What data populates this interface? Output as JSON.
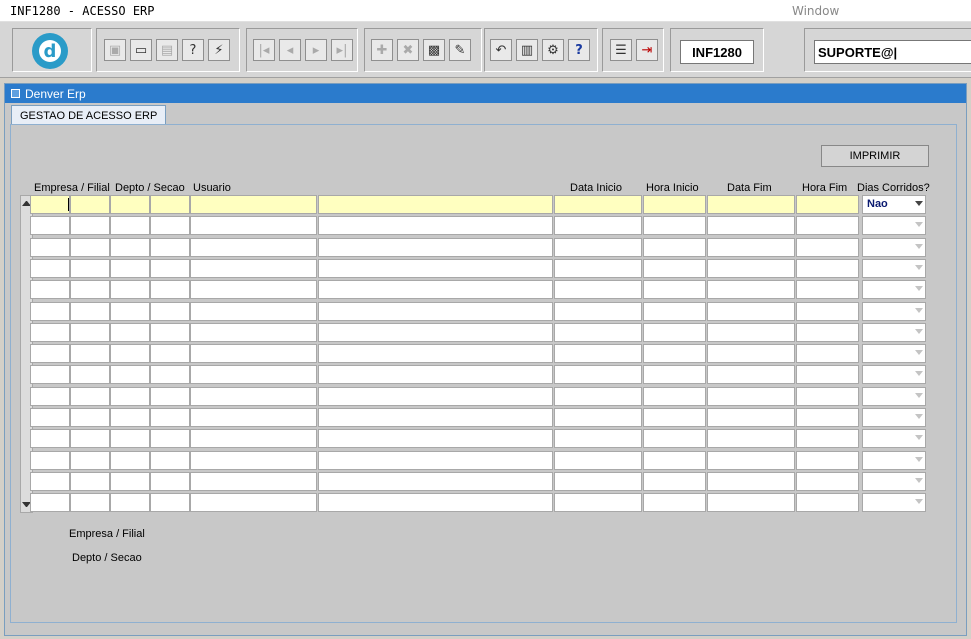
{
  "titlebar": {
    "title": "INF1280 - ACESSO ERP",
    "menu_window": "Window"
  },
  "toolbar": {
    "logo_letter": "d",
    "form_code": "INF1280",
    "user": "SUPORTE@|"
  },
  "window": {
    "title": "Denver Erp",
    "tab": "GESTAO DE ACESSO ERP"
  },
  "form": {
    "print_button": "IMPRIMIR",
    "headers": {
      "empresa": "Empresa / Filial",
      "depto": "Depto / Secao",
      "usuario": "Usuario",
      "data_inicio": "Data Inicio",
      "hora_inicio": "Hora Inicio",
      "data_fim": "Data Fim",
      "hora_fim": "Hora Fim",
      "dias_corridos": "Dias Corridos?"
    },
    "rows_count": 15,
    "dias_corridos_value": "Nao",
    "footer_empresa": "Empresa / Filial",
    "footer_depto": "Depto / Secao"
  },
  "colors": {
    "accent": "#2b7bcc",
    "current_row": "#ffffc0"
  }
}
